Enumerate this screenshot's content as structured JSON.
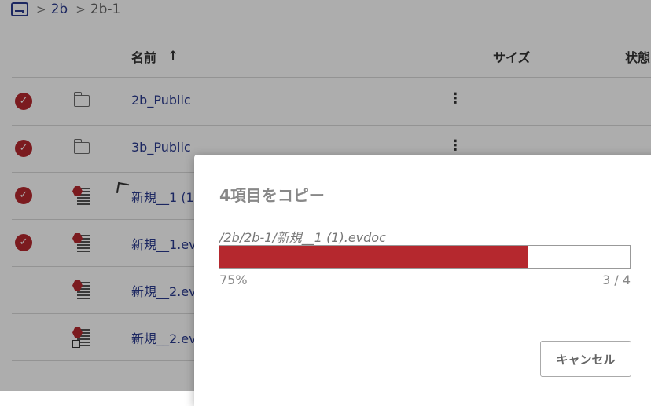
{
  "breadcrumb": {
    "items": [
      "2b",
      "2b-1"
    ],
    "separator": ">"
  },
  "table": {
    "columns": {
      "name": "名前",
      "sort_indicator": "↑",
      "size": "サイズ",
      "status": "状態"
    },
    "rows": [
      {
        "name": "2b_Public",
        "type": "folder",
        "checked": true
      },
      {
        "name": "3b_Public",
        "type": "folder",
        "checked": true
      },
      {
        "name": "新規__1 (1",
        "type": "evdoc",
        "checked": true
      },
      {
        "name": "新規__1.ev",
        "type": "evdoc",
        "checked": true
      },
      {
        "name": "新規__2.ev",
        "type": "evdoc",
        "checked": false
      },
      {
        "name": "新規__2.ev",
        "type": "evdoc-shortcut",
        "checked": false
      }
    ],
    "menu_glyph": "⋮",
    "check_glyph": "✓"
  },
  "dialog": {
    "title": "4項目をコピー",
    "current_file": "/2b/2b-1/新規__1 (1).evdoc",
    "progress_fraction": 0.75,
    "progress_label": "75%",
    "count_label": "3 / 4",
    "cancel_label": "キャンセル"
  },
  "colors": {
    "accent": "#b5282e",
    "link": "#2a3a8f"
  }
}
